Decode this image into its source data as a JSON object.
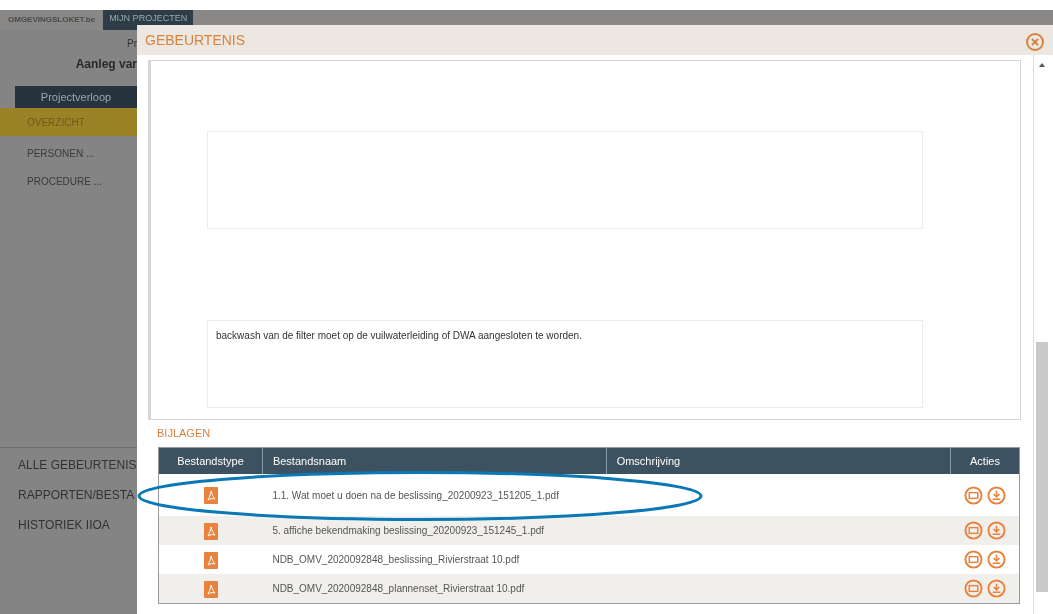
{
  "app_header": {
    "logo": "OMGEVINGSLOKET.be",
    "tab": "MIJN PROJECTEN"
  },
  "project": {
    "label": "Pr",
    "title": "Aanleg var"
  },
  "sidebar": {
    "tab": "Projectverloop",
    "items": [
      {
        "label": "OVERZICHT",
        "selected": true
      },
      {
        "label": "PERSONEN ...",
        "selected": false
      },
      {
        "label": "PROCEDURE ...",
        "selected": false
      }
    ],
    "sections": [
      "ALLE GEBEURTENIS",
      "RAPPORTEN/BESTA",
      "HISTORIEK IIOA"
    ]
  },
  "modal": {
    "title": "GEBEURTENIS",
    "description": "backwash van de filter moet op de vuilwaterleiding of DWA aangesloten te worden.",
    "attachments_title": "BIJLAGEN",
    "table": {
      "columns": [
        "Bestandstype",
        "Bestandsnaam",
        "Omschrijving",
        "Acties"
      ],
      "rows": [
        {
          "kind": "pdf",
          "name": "1.1. Wat moet u doen na de beslissing_20200923_151205_1.pdf"
        },
        {
          "kind": "pdf",
          "name": "5. affiche bekendmaking beslissing_20200923_151245_1.pdf"
        },
        {
          "kind": "pdf",
          "name": "NDB_OMV_2020092848_beslissing_Rivierstraat 10.pdf"
        },
        {
          "kind": "pdf",
          "name": "NDB_OMV_2020092848_plannenset_Rivierstraat 10.pdf"
        }
      ]
    }
  }
}
